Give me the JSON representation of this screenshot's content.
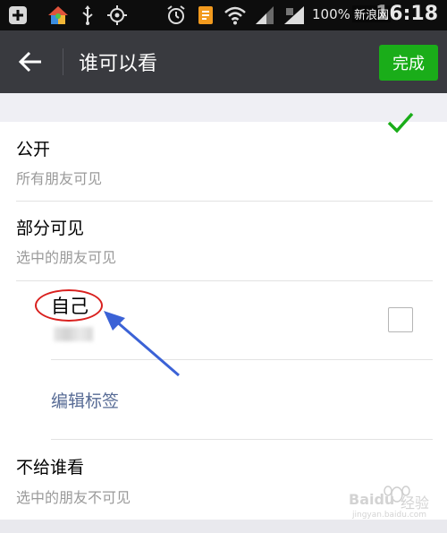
{
  "status_bar": {
    "battery_percent": "100%",
    "time": "16:18",
    "overlay_site": "新浪网"
  },
  "header": {
    "title": "谁可以看",
    "done_label": "完成"
  },
  "options": [
    {
      "title": "公开",
      "subtitle": "所有朋友可见"
    },
    {
      "title": "部分可见",
      "subtitle": "选中的朋友可见"
    },
    {
      "title": "不给谁看",
      "subtitle": "选中的朋友不可见"
    }
  ],
  "tag_item": {
    "label": "自己"
  },
  "edit_tags_label": "编辑标签",
  "watermark": {
    "brand": "Baidu",
    "text": "经验",
    "url": "jingyan.baidu.com"
  },
  "colors": {
    "header_bg": "#393a3f",
    "accent_green": "#1aad19",
    "link_blue": "#576b95",
    "annotation_red": "#d9201e",
    "annotation_arrow": "#3b62d6"
  }
}
